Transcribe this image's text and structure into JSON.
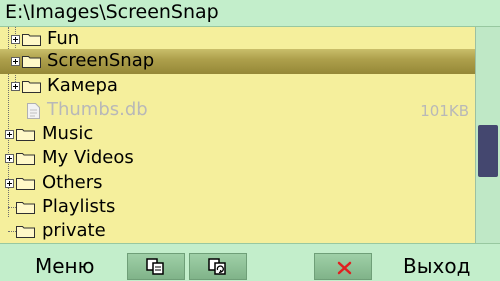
{
  "path": "E:\\Images\\ScreenSnap",
  "items": [
    {
      "label": "Fun",
      "type": "folder",
      "expandable": true
    },
    {
      "label": "ScreenSnap",
      "type": "folder",
      "expandable": true,
      "selected": true
    },
    {
      "label": "Камера",
      "type": "folder",
      "expandable": true
    },
    {
      "label": "Thumbs.db",
      "type": "file",
      "size": "101KB"
    },
    {
      "label": "Music",
      "type": "folder",
      "expandable": true
    },
    {
      "label": "My Videos",
      "type": "folder",
      "expandable": true
    },
    {
      "label": "Others",
      "type": "folder",
      "expandable": true
    },
    {
      "label": "Playlists",
      "type": "folder",
      "expandable": false
    },
    {
      "label": "private",
      "type": "folder",
      "expandable": false
    }
  ],
  "softkeys": {
    "left": "Меню",
    "copy_icon": "copy-icon",
    "refresh_icon": "copy-refresh-icon",
    "delete_icon": "delete-x-icon",
    "right": "Выход"
  },
  "scroll_position": 0.6,
  "colors": {
    "background": "#f5ef9c",
    "bars": "#c3eecb",
    "selection": "#aea04c",
    "scroll_thumb": "#44476f",
    "delete_x": "#e02020"
  }
}
